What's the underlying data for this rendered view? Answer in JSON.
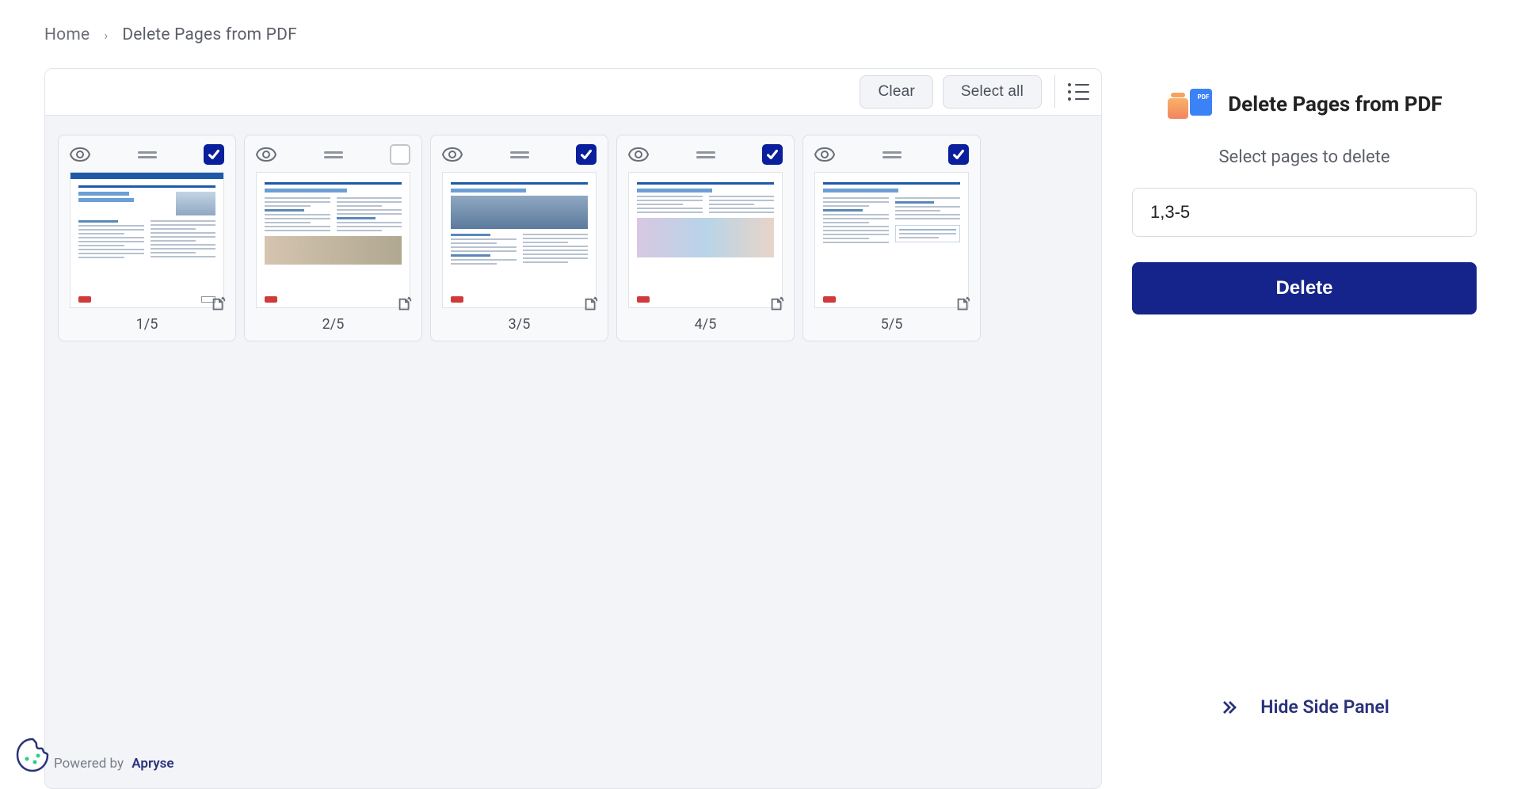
{
  "breadcrumb": {
    "home": "Home",
    "current": "Delete Pages from PDF"
  },
  "toolbar": {
    "clear": "Clear",
    "select_all": "Select all"
  },
  "pages": [
    {
      "label": "1/5",
      "checked": true
    },
    {
      "label": "2/5",
      "checked": false
    },
    {
      "label": "3/5",
      "checked": true
    },
    {
      "label": "4/5",
      "checked": true
    },
    {
      "label": "5/5",
      "checked": true
    }
  ],
  "side": {
    "title": "Delete Pages from PDF",
    "subtitle": "Select pages to delete",
    "input_value": "1,3-5",
    "delete": "Delete",
    "hide": "Hide Side Panel"
  },
  "footer": {
    "powered": "Powered by",
    "brand": "Apryse"
  }
}
